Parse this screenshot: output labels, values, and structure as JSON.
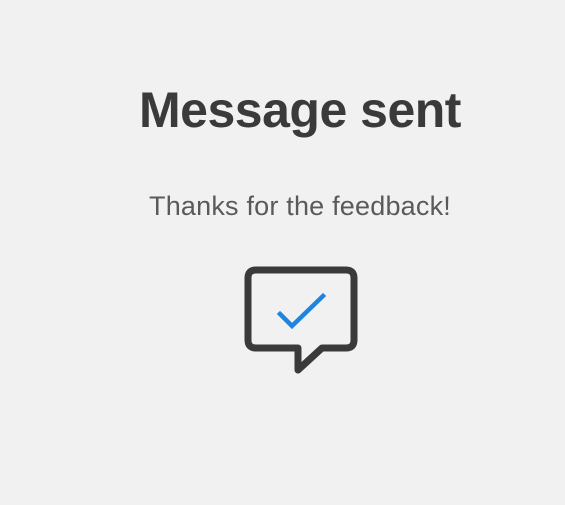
{
  "confirmation": {
    "title": "Message sent",
    "subtitle": "Thanks for the feedback!",
    "icon": "chat-bubble-check-icon",
    "colors": {
      "background": "#f1f1f1",
      "title": "#3a3a3a",
      "subtitle": "#5a5a5a",
      "icon_outline": "#3a3a3a",
      "icon_check": "#1f84e0"
    }
  }
}
